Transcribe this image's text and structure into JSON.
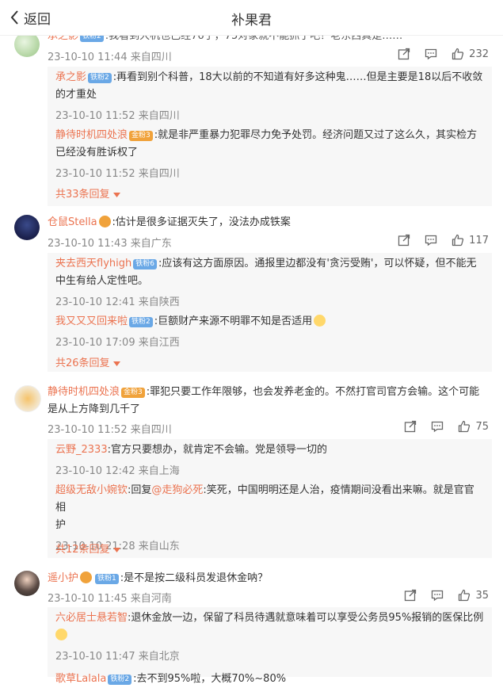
{
  "header": {
    "back_label": "返回",
    "title": "补果君"
  },
  "comments": [
    {
      "user": "承之影",
      "badge": "铁粉2",
      "text": ":我看到大机也已经76了，75对象就不能抓了吧？老东西真是……",
      "time": "23-10-10 11:44",
      "location": "来自四川",
      "likes": "232",
      "replies": [
        {
          "user": "承之影",
          "badge": "铁粉2",
          "text_l1": ":再看到别个科普，18大以前的不知道有好多这种鬼……但是主要是18以后不收敛",
          "text_l2": "的才重处",
          "time": "23-10-10 11:52",
          "location": "来自四川"
        },
        {
          "user": "静待时机四处浪",
          "badge": "金粉3",
          "text_l1": ":就是非严重暴力犯罪尽力免予处罚。经济问题又过了这么久，其实检方",
          "text_l2": "已经没有胜诉权了",
          "time": "23-10-10 11:52",
          "location": "来自四川"
        }
      ],
      "more": "共33条回复"
    },
    {
      "user": "仓鼠Stella",
      "badge": "",
      "text": ":估计是很多证据灭失了，没法办成铁案",
      "time": "23-10-10 11:43",
      "location": "来自广东",
      "likes": "117",
      "replies": [
        {
          "user": "夹去西天flyhigh",
          "badge": "铁粉6",
          "text_l1": ":应该有这方面原因。通报里边都没有'贪污受贿'，可以怀疑，但不能无",
          "text_l2": "中生有给人定性吧。",
          "time": "23-10-10 12:41",
          "location": "来自陕西"
        },
        {
          "user": "我又又又回来啦",
          "badge": "铁粉2",
          "text_l1": ":巨额财产来源不明罪不知是否适用",
          "text_l2": "",
          "time": "23-10-10 17:09",
          "location": "来自江西"
        }
      ],
      "more": "共26条回复"
    },
    {
      "user": "静待时机四处浪",
      "badge": "金粉3",
      "text_l1": ":罪犯只要工作年限够，也会发养老金的。不然打官司官方会输。这个可能",
      "text_l2": "是从上方降到几千了",
      "time": "23-10-10 11:52",
      "location": "来自四川",
      "likes": "75",
      "replies": [
        {
          "user": "云野_2333",
          "badge": "",
          "text_l1": ":官方只要想办，就肯定不会输。党是领导一切的",
          "text_l2": "",
          "time": "23-10-10 12:42",
          "location": "来自上海"
        },
        {
          "user": "超级无敌小婉钦",
          "badge": "",
          "text_l1": ":回复",
          "mention": "@走狗必死",
          "text_l1b": ":笑死，中国明明还是人治，疫情期间没看出来嘛。就是官官相",
          "text_l2": "护",
          "time": "23-10-10 21:28",
          "location": "来自山东"
        }
      ],
      "more": "共12条回复"
    },
    {
      "user": "遥小护",
      "badge": "铁粉1",
      "text": ":是不是按二级科员发退休金呐？",
      "time": "23-10-10 11:45",
      "location": "来自河南",
      "likes": "35",
      "replies": [
        {
          "user": "六必居士悬若智",
          "badge": "",
          "text_l1": ":退休金放一边，保留了科员待遇就意味着可以享受公务员95%报销的医保比例",
          "text_l2": "",
          "time": "23-10-10 11:47",
          "location": "来自北京"
        },
        {
          "user": "歌草Lalala",
          "badge": "铁粉2",
          "text_l1": ":去不到95%啦，大概70%~80%",
          "text_l2": "",
          "time": "",
          "location": ""
        }
      ],
      "more": ""
    }
  ]
}
